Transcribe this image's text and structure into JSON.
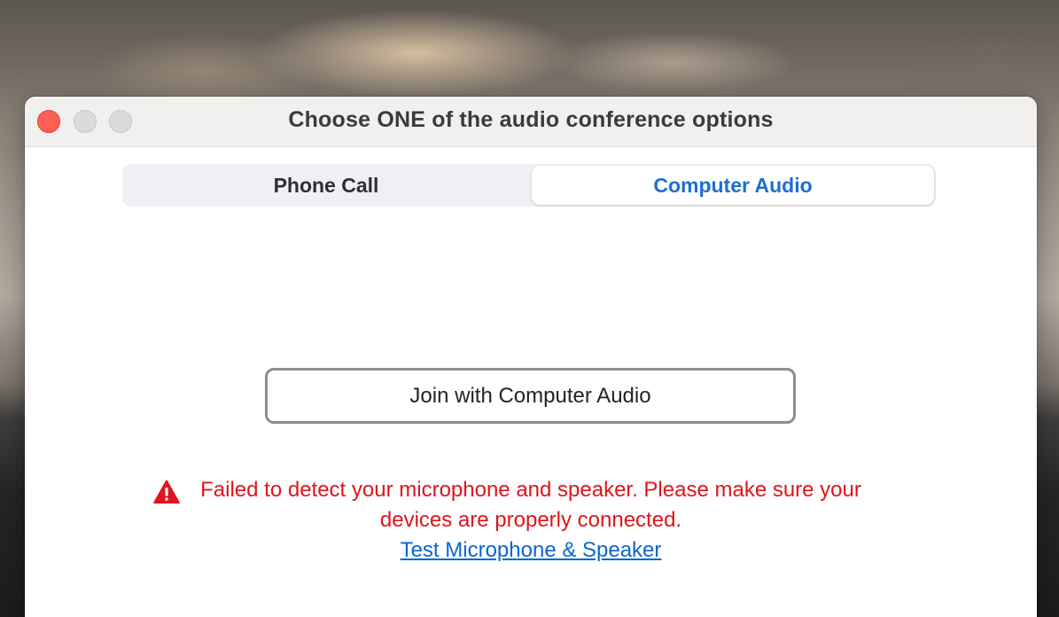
{
  "window": {
    "title": "Choose ONE of the audio conference options"
  },
  "tabs": [
    {
      "label": "Phone Call",
      "selected": false
    },
    {
      "label": "Computer Audio",
      "selected": true
    }
  ],
  "join_button": {
    "label": "Join with Computer Audio"
  },
  "error": {
    "icon": "warning-icon",
    "message": "Failed to detect your microphone and speaker. Please make sure your devices are properly connected.",
    "link_label": "Test Microphone & Speaker"
  },
  "colors": {
    "accent": "#1e6fd1",
    "error": "#e0141c",
    "link": "#0b66d0",
    "close": "#fe5f57"
  }
}
